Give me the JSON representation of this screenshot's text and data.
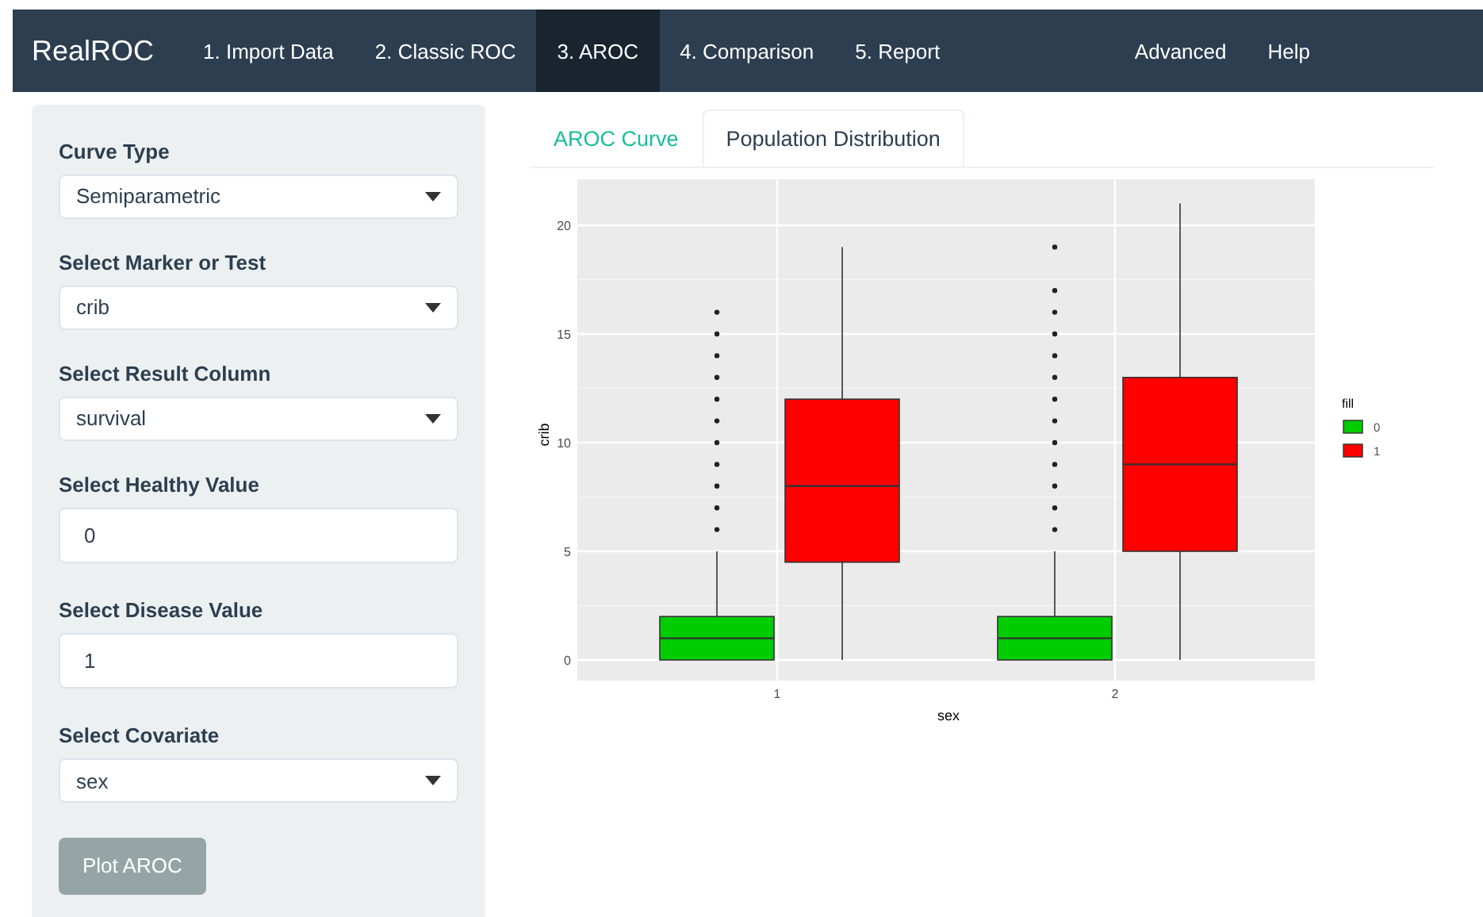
{
  "navbar": {
    "brand": "RealROC",
    "items": [
      {
        "label": "1. Import Data",
        "selected": false
      },
      {
        "label": "2. Classic ROC",
        "selected": false
      },
      {
        "label": "3. AROC",
        "selected": true
      },
      {
        "label": "4. Comparison",
        "selected": false
      },
      {
        "label": "5. Report",
        "selected": false
      }
    ],
    "right_items": [
      "Advanced",
      "Help"
    ]
  },
  "sidebar": {
    "fields": [
      {
        "kind": "select",
        "label": "Curve Type",
        "value": "Semiparametric"
      },
      {
        "kind": "select",
        "label": "Select Marker or Test",
        "value": "crib"
      },
      {
        "kind": "select",
        "label": "Select Result Column",
        "value": "survival"
      },
      {
        "kind": "number",
        "label": "Select Healthy Value",
        "value": "0"
      },
      {
        "kind": "number",
        "label": "Select Disease Value",
        "value": "1"
      },
      {
        "kind": "select",
        "label": "Select Covariate",
        "value": "sex"
      }
    ],
    "button": "Plot AROC"
  },
  "tabs": [
    {
      "label": "AROC Curve",
      "selected": false
    },
    {
      "label": "Population Distribution",
      "selected": true
    }
  ],
  "chart": {
    "xlabel": "sex",
    "ylabel": "crib",
    "x_ticks": [
      "1",
      "2"
    ],
    "y_ticks": [
      "20",
      "15",
      "10",
      "5",
      "0"
    ],
    "legend_title": "fill",
    "legend": [
      {
        "label": "0",
        "color": "#00cd00"
      },
      {
        "label": "1",
        "color": "#ff0000"
      }
    ]
  }
}
